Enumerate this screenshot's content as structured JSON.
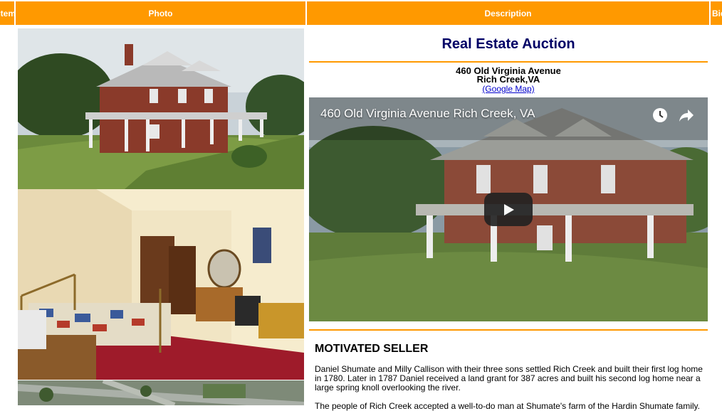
{
  "table_header": {
    "item": "Item",
    "photo": "Photo",
    "description": "Description",
    "bid": "Bid"
  },
  "listing": {
    "title": "Real Estate Auction",
    "address_line1": "460 Old Virginia Avenue",
    "address_line2": "Rich Creek,VA",
    "map_link": "(Google Map)",
    "video": {
      "title": "460 Old Virginia Avenue Rich Creek, VA",
      "icons": [
        "clock-icon",
        "share-icon",
        "play-icon"
      ]
    },
    "section_heading": "MOTIVATED SELLER",
    "paragraph1": "Daniel Shumate and Milly Callison with their three sons settled Rich Creek and built their first log home in 1780. Later in 1787 Daniel received a land grant for 387 acres and built his second log home near a large spring knoll overlooking the river.",
    "paragraph2": "The people of Rich Creek accepted a well-to-do man at Shumate's farm of the Hardin Shumate family."
  },
  "colors": {
    "header_bg": "#ff9900",
    "title": "#000066",
    "link": "#0000cc",
    "rule": "#ff9900"
  }
}
